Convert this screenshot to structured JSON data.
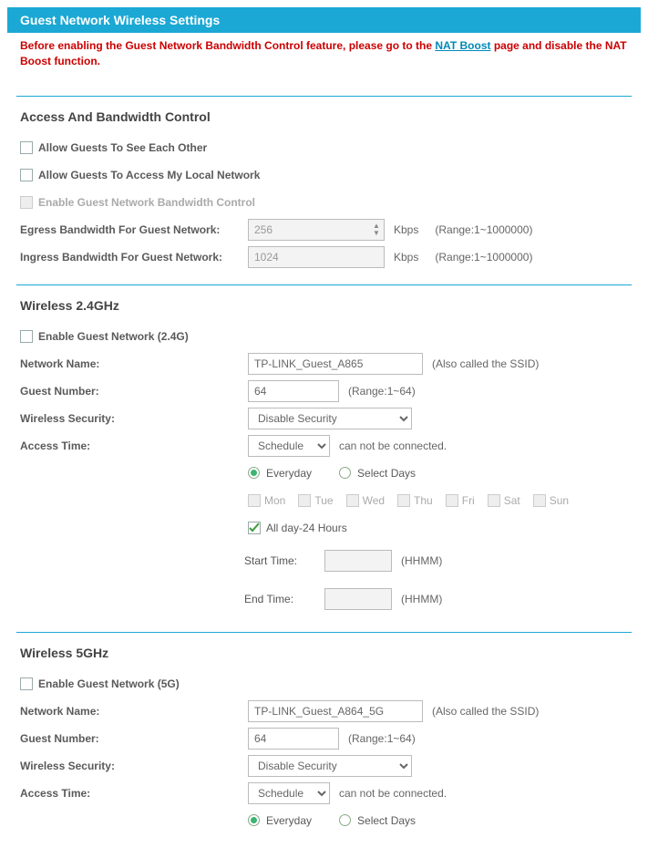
{
  "header": {
    "title": "Guest Network Wireless Settings"
  },
  "warning": {
    "prefix": "Before enabling the Guest Network Bandwidth Control feature, please go to the ",
    "link_text": "NAT Boost",
    "suffix": " page and disable the NAT Boost function."
  },
  "access": {
    "title": "Access And Bandwidth Control",
    "allow_see_each_other": "Allow Guests To See Each Other",
    "allow_access_local": "Allow Guests To Access My Local Network",
    "enable_bw_control": "Enable Guest Network Bandwidth Control",
    "egress_label": "Egress Bandwidth For Guest Network:",
    "egress_value": "256",
    "ingress_label": "Ingress Bandwidth For Guest Network:",
    "ingress_value": "1024",
    "unit": "Kbps",
    "range": "(Range:1~1000000)"
  },
  "w24": {
    "title": "Wireless 2.4GHz",
    "enable": "Enable Guest Network (2.4G)",
    "network_name_label": "Network Name:",
    "network_name": "TP-LINK_Guest_A865",
    "ssid_hint": "(Also called the SSID)",
    "guest_number_label": "Guest Number:",
    "guest_number": "64",
    "guest_number_range": "(Range:1~64)",
    "security_label": "Wireless Security:",
    "security_value": "Disable Security",
    "access_time_label": "Access Time:",
    "access_time_value": "Schedule",
    "access_time_hint": "can not be connected.",
    "radio_everyday": "Everyday",
    "radio_selectdays": "Select Days",
    "days": [
      "Mon",
      "Tue",
      "Wed",
      "Thu",
      "Fri",
      "Sat",
      "Sun"
    ],
    "allday_label": "All day-24 Hours",
    "start_label": "Start Time:",
    "end_label": "End Time:",
    "hhmm": "(HHMM)"
  },
  "w5": {
    "title": "Wireless 5GHz",
    "enable": "Enable Guest Network (5G)",
    "network_name_label": "Network Name:",
    "network_name": "TP-LINK_Guest_A864_5G",
    "ssid_hint": "(Also called the SSID)",
    "guest_number_label": "Guest Number:",
    "guest_number": "64",
    "guest_number_range": "(Range:1~64)",
    "security_label": "Wireless Security:",
    "security_value": "Disable Security",
    "access_time_label": "Access Time:",
    "access_time_value": "Schedule",
    "access_time_hint": "can not be connected.",
    "radio_everyday": "Everyday",
    "radio_selectdays": "Select Days"
  }
}
